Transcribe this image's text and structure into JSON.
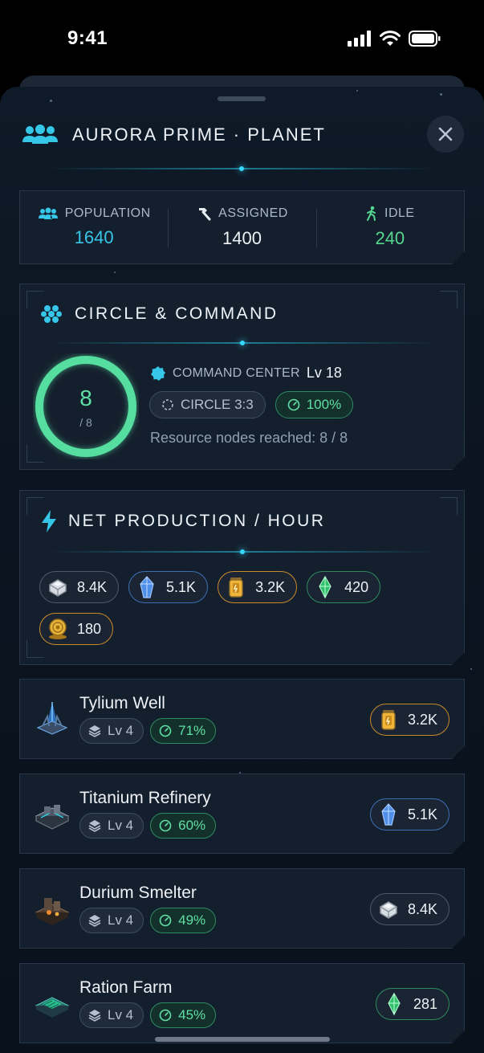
{
  "status_bar": {
    "time": "9:41"
  },
  "header": {
    "title": "AURORA PRIME · PLANET",
    "icon": "people-icon",
    "close_icon": "close-icon"
  },
  "population": {
    "population_label": "POPULATION",
    "population_value": "1640",
    "assigned_label": "ASSIGNED",
    "assigned_value": "1400",
    "idle_label": "IDLE",
    "idle_value": "240"
  },
  "circle": {
    "title": "CIRCLE & COMMAND",
    "ring_value": "8",
    "ring_total": "/ 8",
    "ring_fraction": 1.0,
    "command_label": "COMMAND CENTER",
    "command_level": "Lv 18",
    "circle_badge": "CIRCLE 3:3",
    "efficiency_badge": "100%",
    "nodes_text": "Resource nodes reached: 8 / 8"
  },
  "production": {
    "title": "NET PRODUCTION / HOUR",
    "resources": [
      {
        "name": "titanium-icon",
        "value": "8.4K",
        "color": "#c9ced6"
      },
      {
        "name": "crystal-icon",
        "value": "5.1K",
        "color": "#6fa8ff"
      },
      {
        "name": "tylium-icon",
        "value": "3.2K",
        "color": "#f2b63c"
      },
      {
        "name": "ration-icon",
        "value": "420",
        "color": "#38d878"
      },
      {
        "name": "cubit-icon",
        "value": "180",
        "color": "#e7b948"
      }
    ]
  },
  "buildings": [
    {
      "name": "Tylium Well",
      "level": "Lv 4",
      "efficiency": "71%",
      "output": "3.2K",
      "resource": "tylium-icon"
    },
    {
      "name": "Titanium Refinery",
      "level": "Lv 4",
      "efficiency": "60%",
      "output": "5.1K",
      "resource": "crystal-icon"
    },
    {
      "name": "Durium Smelter",
      "level": "Lv 4",
      "efficiency": "49%",
      "output": "8.4K",
      "resource": "titanium-icon"
    },
    {
      "name": "Ration Farm",
      "level": "Lv 4",
      "efficiency": "45%",
      "output": "281",
      "resource": "ration-icon"
    }
  ]
}
